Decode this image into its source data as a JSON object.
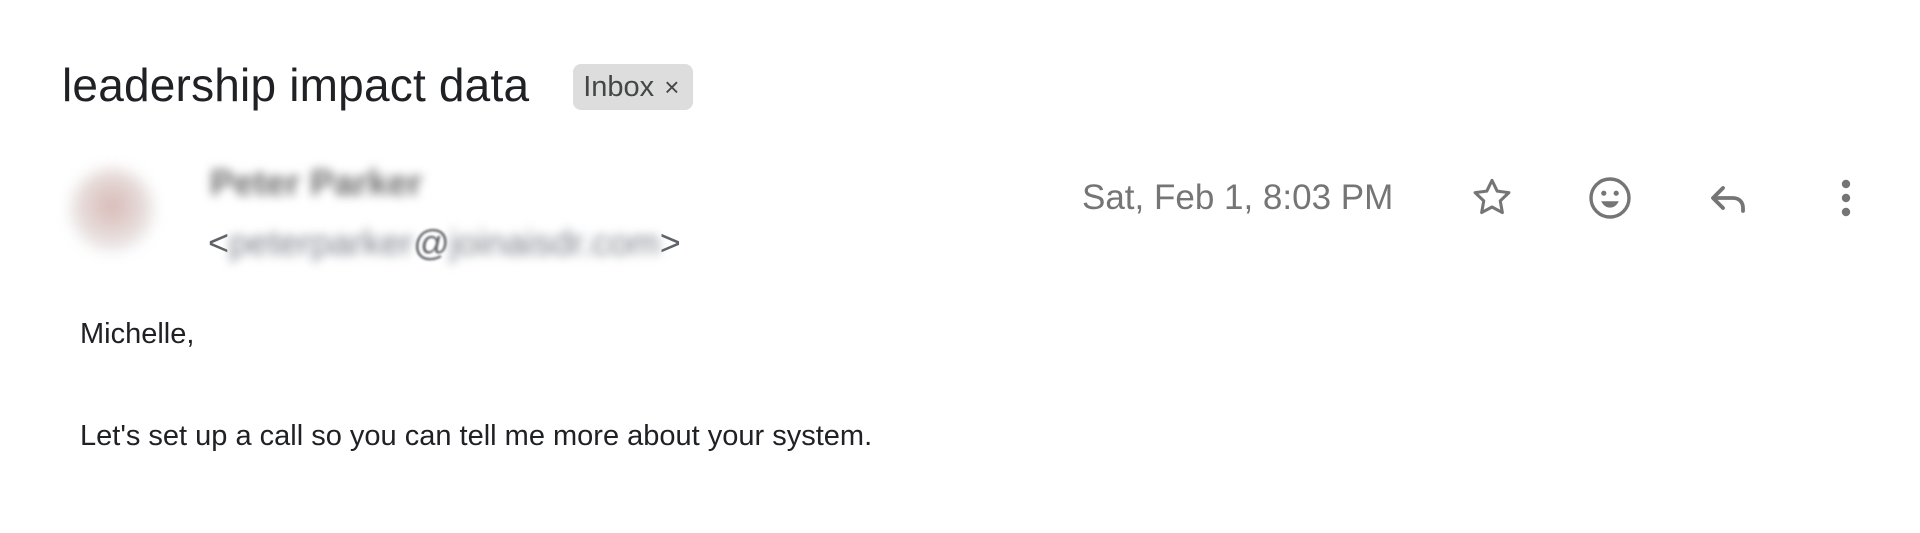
{
  "email": {
    "subject": "leadership impact data",
    "label": {
      "name": "Inbox",
      "close_glyph": "×"
    },
    "sender": {
      "name": "Peter Parker",
      "email_open": "<",
      "email_user": "peterparker",
      "email_at": "@",
      "email_domain": "joinaisdr.com",
      "email_close": ">"
    },
    "date": "Sat, Feb 1, 8:03 PM",
    "actions": {
      "star": "star-icon",
      "emoji": "emoji-reaction-icon",
      "reply": "reply-icon",
      "more": "more-vertical-icon"
    },
    "body": {
      "greeting": "Michelle,",
      "message": "Let's set up a call so you can tell me more about your system."
    }
  },
  "colors": {
    "label_chip_bg": "#dddddd",
    "icon_gray": "#757575",
    "text_dark": "#202124"
  }
}
